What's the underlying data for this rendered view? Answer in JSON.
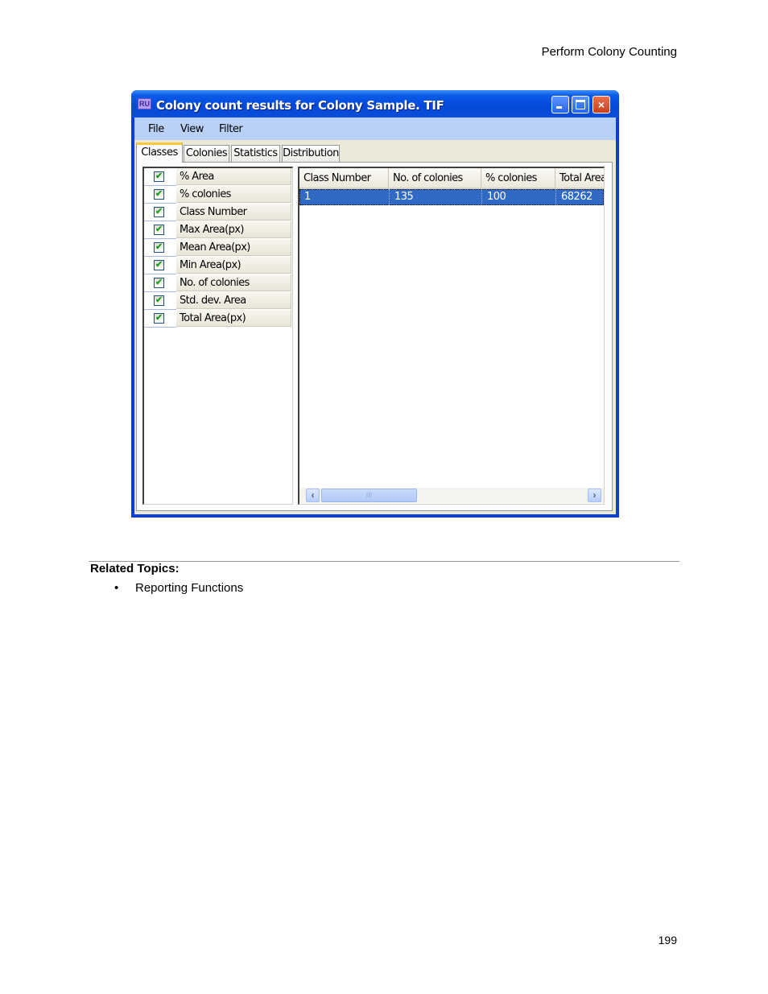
{
  "page": {
    "header": "Perform Colony Counting",
    "page_number": "199"
  },
  "window": {
    "title": "Colony count results for Colony Sample. TIF",
    "app_icon": "app-logo-icon",
    "controls": {
      "minimize": "minimize-icon",
      "maximize": "maximize-icon",
      "close": "×"
    },
    "menu": [
      "File",
      "View",
      "Filter"
    ],
    "tabs": [
      {
        "label": "Classes",
        "active": true
      },
      {
        "label": "Colonies",
        "active": false
      },
      {
        "label": "Statistics",
        "active": false
      },
      {
        "label": "Distribution",
        "active": false
      }
    ],
    "properties": [
      {
        "label": "% Area",
        "checked": true
      },
      {
        "label": "% colonies",
        "checked": true
      },
      {
        "label": "Class Number",
        "checked": true
      },
      {
        "label": "Max Area(px)",
        "checked": true
      },
      {
        "label": "Mean Area(px)",
        "checked": true
      },
      {
        "label": "Min Area(px)",
        "checked": true
      },
      {
        "label": "No. of colonies",
        "checked": true
      },
      {
        "label": "Std. dev. Area",
        "checked": true
      },
      {
        "label": "Total Area(px)",
        "checked": true
      }
    ],
    "check_glyph": "✔",
    "grid": {
      "columns": [
        "Class Number",
        "No. of colonies",
        "% colonies",
        "Total Area"
      ],
      "rows": [
        [
          "1",
          "135",
          "100",
          "68262"
        ]
      ],
      "selected_row": 0
    },
    "scrollbar": {
      "left": "‹",
      "right": "›",
      "thumb": "III"
    }
  },
  "related": {
    "title": "Related Topics:",
    "bullet": "•",
    "items": [
      "Reporting Functions"
    ]
  }
}
